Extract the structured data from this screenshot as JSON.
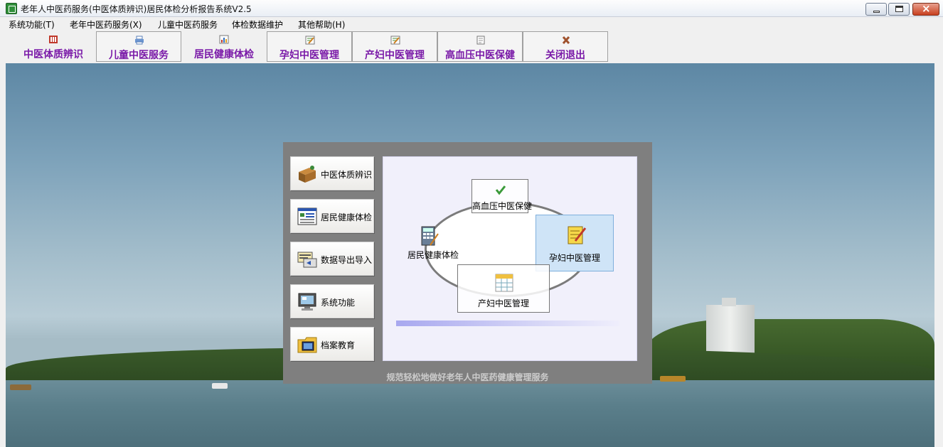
{
  "window": {
    "title": "老年人中医药服务(中医体质辨识)居民体检分析报告系统V2.5"
  },
  "menu": [
    {
      "label": "系统功能(T)"
    },
    {
      "label": "老年中医药服务(X)"
    },
    {
      "label": "儿童中医药服务"
    },
    {
      "label": "体检数据维护"
    },
    {
      "label": "其他帮助(H)"
    }
  ],
  "toolbar": [
    {
      "label": "中医体质辨识",
      "icon": "building-icon"
    },
    {
      "label": "儿童中医服务",
      "icon": "printer-icon"
    },
    {
      "label": "居民健康体检",
      "icon": "bar-chart-icon"
    },
    {
      "label": "孕妇中医管理",
      "icon": "edit-form-icon"
    },
    {
      "label": "产妇中医管理",
      "icon": "edit-form-icon"
    },
    {
      "label": "高血压中医保健",
      "icon": "notepad-icon"
    },
    {
      "label": "关闭退出",
      "icon": "close-x-icon"
    }
  ],
  "sidebar": [
    {
      "label": "中医体质辨识",
      "icon": "desk-icon"
    },
    {
      "label": "居民健康体检",
      "icon": "window-list-icon"
    },
    {
      "label": "数据导出导入",
      "icon": "database-transfer-icon"
    },
    {
      "label": "系统功能",
      "icon": "monitor-icon"
    },
    {
      "label": "档案教育",
      "icon": "folder-icon"
    }
  ],
  "diagram": {
    "nodes": [
      {
        "label": "高血压中医保健",
        "icon": "checkmark-icon"
      },
      {
        "label": "居民健康体检",
        "icon": "calculator-icon"
      },
      {
        "label": "孕妇中医管理",
        "icon": "notepad-pencil-icon",
        "selected": true
      },
      {
        "label": "产妇中医管理",
        "icon": "calendar-icon"
      }
    ]
  },
  "slogan": "规范轻松地做好老年人中医药健康管理服务",
  "colors": {
    "toolbar_text": "#7a1aa8",
    "selected_node": "#cfe4f7",
    "panel_bg": "#7f7f7f"
  }
}
